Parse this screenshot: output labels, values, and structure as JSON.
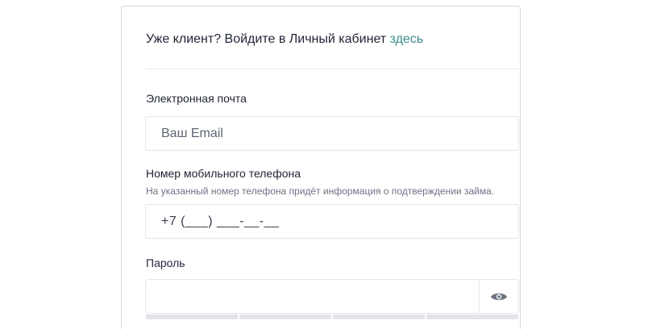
{
  "login": {
    "prompt": "Уже клиент? Войдите в Личный кабинет ",
    "link_label": "здесь"
  },
  "email": {
    "label": "Электронная почта",
    "placeholder": "Ваш Email",
    "value": ""
  },
  "phone": {
    "label": "Номер мобильного телефона",
    "hint": "На указанный номер телефона придёт информация о подтверждении займа.",
    "value": "+7 (___) ___-__-__"
  },
  "password": {
    "label": "Пароль",
    "value": "",
    "toggle_icon": "eye-icon",
    "strength_segments": 4,
    "strength_filled": 0
  },
  "colors": {
    "link": "#3a8d8a",
    "border": "#e4e6ed",
    "icon": "#6b7280"
  }
}
